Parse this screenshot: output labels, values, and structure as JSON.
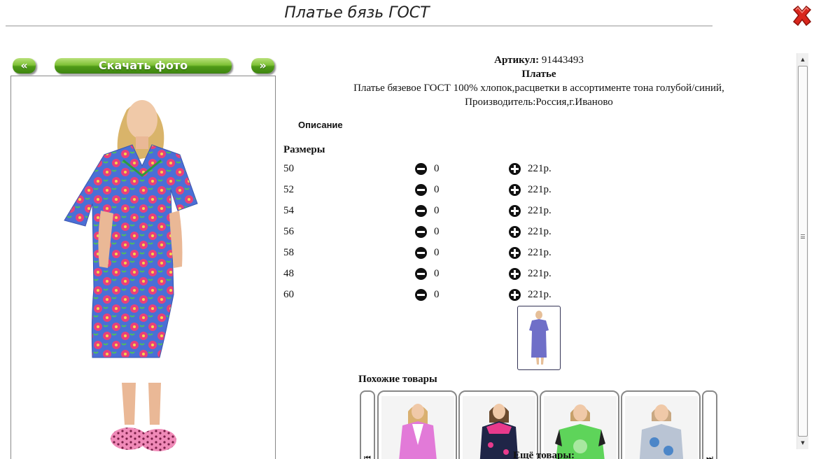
{
  "header": {
    "title": "Платье бязь ГОСТ"
  },
  "gallery": {
    "prev_label": "«",
    "next_label": "»",
    "download_label": "Скачать фото"
  },
  "product": {
    "article_label": "Артикул:",
    "article_value": "91443493",
    "name": "Платье",
    "description_line1": "Платье бязевое ГОСТ 100% хлопок,расцветки в ассортименте тона голубой/синий,",
    "description_line2": "Производитель:Россия,г.Иваново"
  },
  "sections": {
    "description_label": "Описание",
    "sizes_label": "Размеры",
    "similar_label": "Похожие товары",
    "more_label": "Ещё товары:"
  },
  "sizes": [
    {
      "size": "50",
      "qty": "0",
      "price": "221р."
    },
    {
      "size": "52",
      "qty": "0",
      "price": "221р."
    },
    {
      "size": "54",
      "qty": "0",
      "price": "221р."
    },
    {
      "size": "56",
      "qty": "0",
      "price": "221р."
    },
    {
      "size": "58",
      "qty": "0",
      "price": "221р."
    },
    {
      "size": "48",
      "qty": "0",
      "price": "221р."
    },
    {
      "size": "60",
      "qty": "0",
      "price": "221р."
    }
  ],
  "carousel": {
    "left_glyph": "⏮",
    "right_glyph": "⏭"
  },
  "colors": {
    "button_green": "#5aa81c",
    "close_red": "#d9261c",
    "dress_blue": "#4a6fd6",
    "flower_pink": "#e8407a"
  }
}
